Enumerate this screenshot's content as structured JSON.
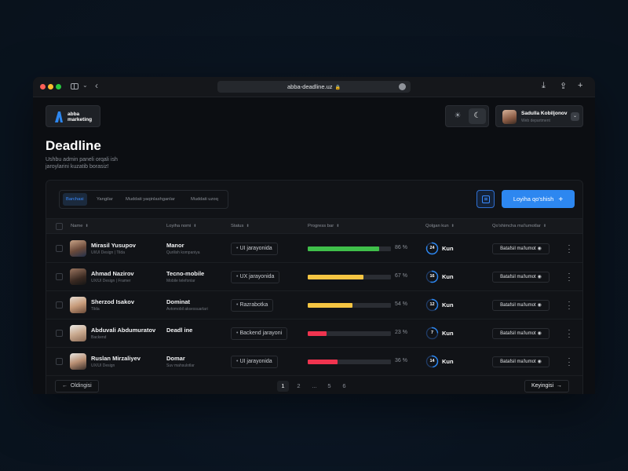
{
  "browser": {
    "url": "abba-deadline.uz",
    "lock_icon": "lock-icon",
    "icons": [
      "sidebar-icon",
      "chevron-down-icon",
      "back-arrow-icon",
      "download-icon",
      "share-icon",
      "new-tab-plus-icon"
    ]
  },
  "brand": {
    "line1": "abba",
    "line2": "marketing",
    "mark_color": "#2d87f0"
  },
  "theme": {
    "active": "dark",
    "icons": [
      "sun-icon",
      "moon-icon"
    ]
  },
  "user": {
    "name": "Sadulla Kobiljonov",
    "role": "Web department"
  },
  "page": {
    "title": "Deadline",
    "subtitle": "Ushbu admin paneli orqali ish jaroylarini kuzatib borasiz!"
  },
  "filters": {
    "tabs": [
      "Barchasi",
      "Yangilar",
      "Muddati yaqinlashganlar",
      "Muddati uzoq"
    ],
    "active_index": 0
  },
  "actions": {
    "add_project": "Loyiha qo'shish",
    "accent": "#2d87f0"
  },
  "table": {
    "columns": [
      "Name",
      "Loyiha nomi",
      "Status",
      "Progress bar",
      "Qolgan kun",
      "Qo'shimcha ma'lumotlar"
    ],
    "detail_label": "Batafsil ma'lumot",
    "days_unit": "Kun",
    "rows": [
      {
        "name": "Mirasil Yusupov",
        "role": "UI/UI Design  |  Tilda",
        "project": "Manor",
        "project_sub": "Qurilish kompaniya",
        "status": "UI jarayonida",
        "progress": 86,
        "progress_label": "86 %",
        "progress_color": "#3fbf4a",
        "days": "24"
      },
      {
        "name": "Ahmad Nazirov",
        "role": "UX/UI Design  |  Framer",
        "project": "Tecno-mobile",
        "project_sub": "Mobile telefonlar",
        "status": "UX jarayonida",
        "progress": 67,
        "progress_label": "67 %",
        "progress_color": "#f5c542",
        "days": "16"
      },
      {
        "name": "Sherzod Isakov",
        "role": "Tilda",
        "project": "Dominat",
        "project_sub": "Avtomobil aksessuarlari",
        "status": "Razrabotka",
        "progress": 54,
        "progress_label": "54 %",
        "progress_color": "#f5c542",
        "days": "12"
      },
      {
        "name": "Abduvali Abdumuratov",
        "role": "Backend",
        "project": "Deadl ine",
        "project_sub": "",
        "status": "Backend jarayoni",
        "progress": 23,
        "progress_label": "23 %",
        "progress_color": "#f0344f",
        "days": "7"
      },
      {
        "name": "Ruslan Mirzaliyev",
        "role": "UX/UI Design",
        "project": "Domar",
        "project_sub": "Suv mahsulotlar",
        "status": "UI jarayonida",
        "progress": 36,
        "progress_label": "36 %",
        "progress_color": "#f0344f",
        "days": "14"
      }
    ]
  },
  "pagination": {
    "prev": "Oldingisi",
    "next": "Keyingisi",
    "pages": [
      "1",
      "2",
      "...",
      "5",
      "6"
    ],
    "active": "1"
  }
}
